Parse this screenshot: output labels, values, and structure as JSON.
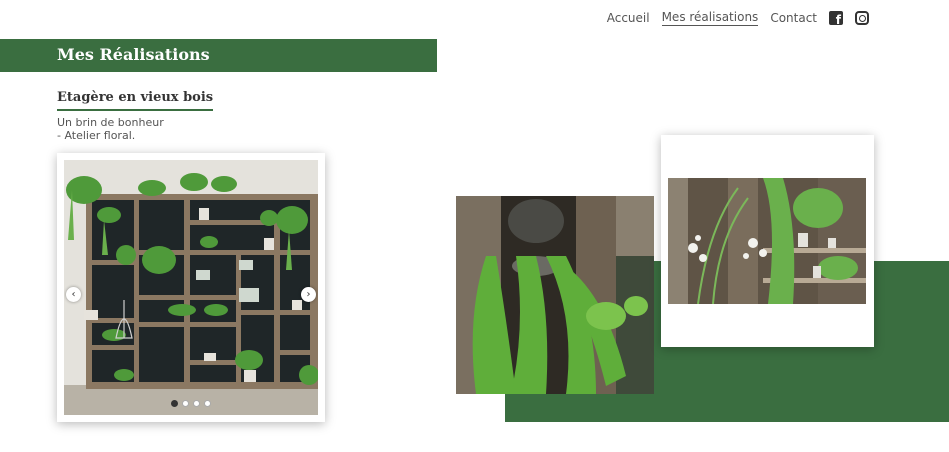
{
  "nav": {
    "items": [
      "Accueil",
      "Mes réalisations",
      "Contact"
    ],
    "active_index": 1,
    "icons": [
      "facebook-icon",
      "instagram-icon"
    ]
  },
  "page": {
    "title": "Mes Réalisations"
  },
  "project": {
    "title": "Etagère en vieux bois",
    "description_line1": "Un brin de bonheur",
    "description_line2": "- Atelier floral."
  },
  "carousel": {
    "prev_glyph": "‹",
    "next_glyph": "›",
    "slide_count": 4,
    "active_slide": 0
  },
  "colors": {
    "brand_green": "#3a6e40",
    "text": "#444444"
  }
}
